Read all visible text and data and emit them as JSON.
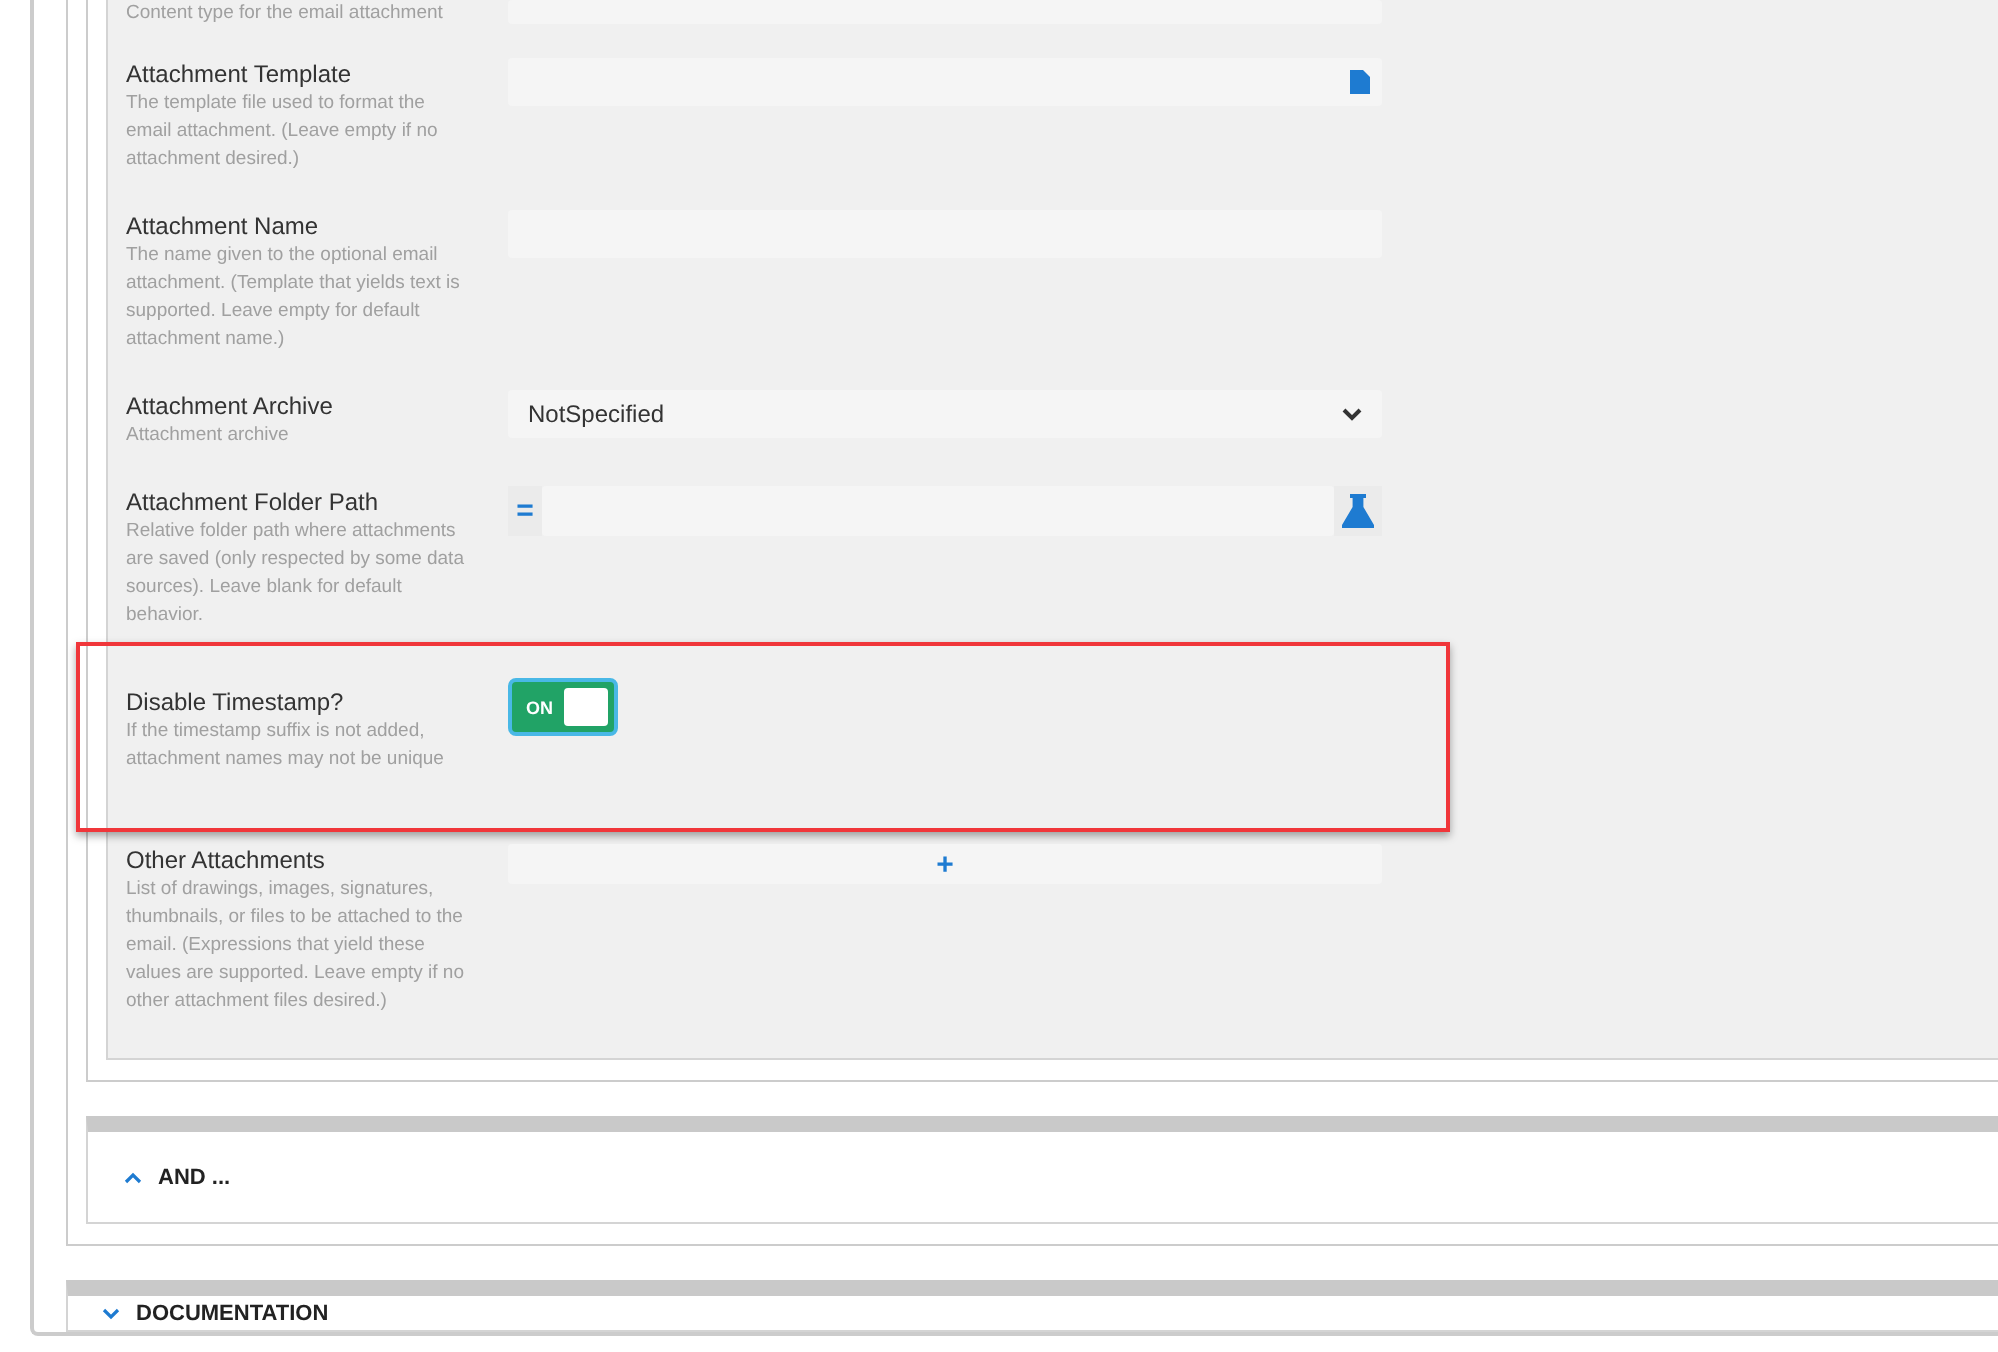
{
  "top_partial": {
    "description": "Content type for the email attachment"
  },
  "fields": [
    {
      "kind": "file",
      "label": "Attachment Template",
      "description": "The template file used to format the email attachment. (Leave empty if no attachment desired.)"
    },
    {
      "kind": "text",
      "label": "Attachment Name",
      "description": "The name given to the optional email attachment. (Template that yields text is supported. Leave empty for default attachment name.)"
    },
    {
      "kind": "select",
      "label": "Attachment Archive",
      "description": "Attachment archive",
      "value": "NotSpecified"
    },
    {
      "kind": "expression",
      "label": "Attachment Folder Path",
      "description": "Relative folder path where attachments are saved (only respected by some data sources). Leave blank for default behavior.",
      "prefix": "="
    },
    {
      "kind": "toggle",
      "label": "Disable Timestamp?",
      "description": "If the timestamp suffix is not added, attachment names may not be unique",
      "on": true,
      "toggle_text": "ON",
      "highlighted": true
    },
    {
      "kind": "list",
      "label": "Other Attachments",
      "description": "List of drawings, images, signatures, thumbnails, or files to be attached to the email. (Expressions that yield these values are supported. Leave empty if no other attachment files desired.)",
      "add_text": "+"
    }
  ],
  "sections": [
    {
      "title": "AND ...",
      "expanded": true
    },
    {
      "title": "DOCUMENTATION",
      "expanded": false
    }
  ]
}
